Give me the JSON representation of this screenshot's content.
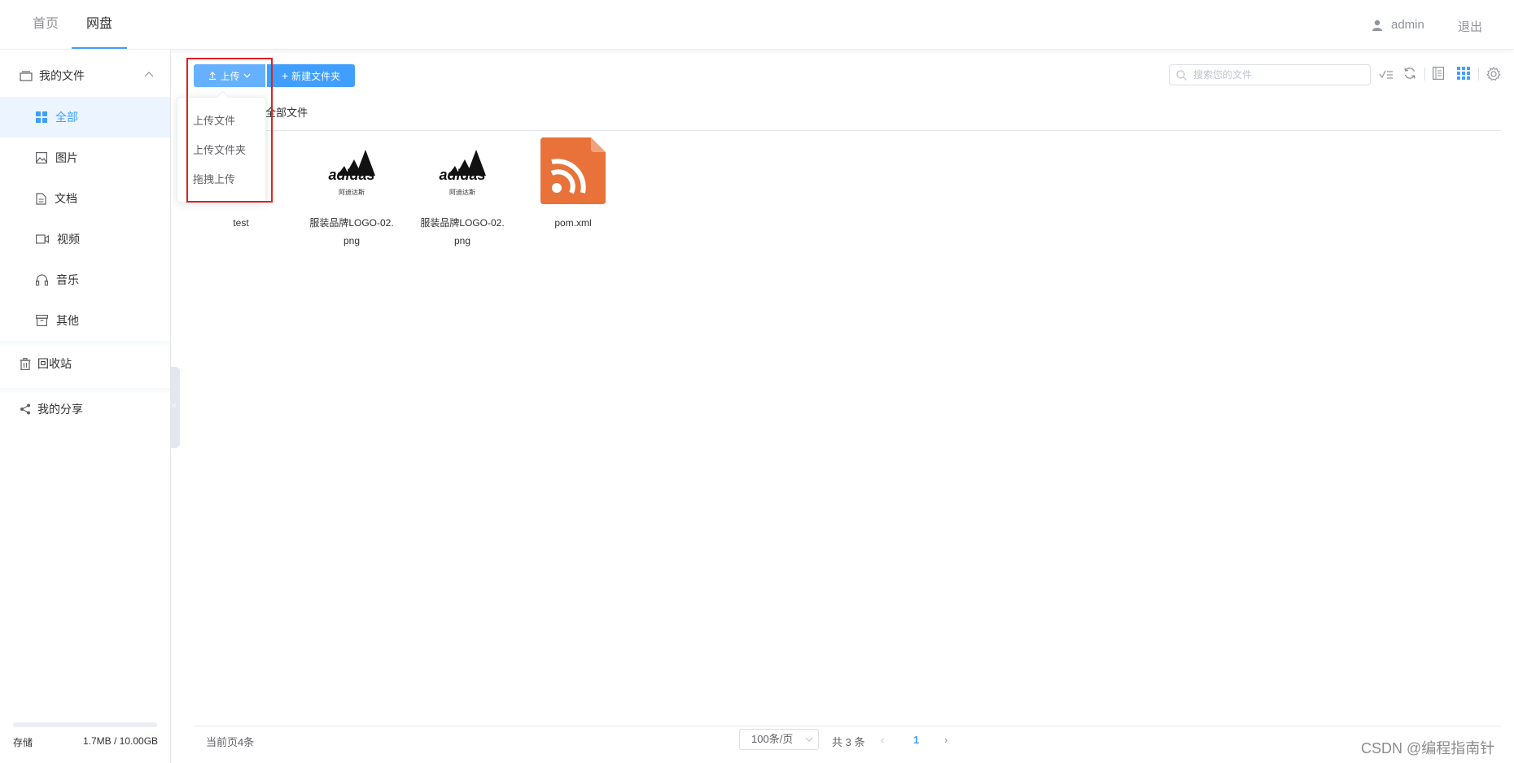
{
  "nav": {
    "home": "首页",
    "disk": "网盘",
    "user": "admin",
    "logout": "退出"
  },
  "sidebar": {
    "group": "我的文件",
    "items": [
      {
        "label": "全部",
        "icon": "grid-icon",
        "active": true
      },
      {
        "label": "图片",
        "icon": "image-icon"
      },
      {
        "label": "文档",
        "icon": "document-icon"
      },
      {
        "label": "视频",
        "icon": "video-icon"
      },
      {
        "label": "音乐",
        "icon": "headphones-icon"
      },
      {
        "label": "其他",
        "icon": "archive-icon"
      }
    ],
    "recycle": "回收站",
    "share": "我的分享",
    "storage_label": "存储",
    "storage_value": "1.7MB / 10.00GB",
    "storage_fraction": 0.0002
  },
  "toolbar": {
    "upload": "上传",
    "new_folder": "新建文件夹",
    "search_placeholder": "搜索您的文件"
  },
  "upload_menu": [
    "上传文件",
    "上传文件夹",
    "拖拽上传"
  ],
  "breadcrumb": "全部文件",
  "files": [
    {
      "name": "test",
      "type": "folder"
    },
    {
      "name": "服装品牌LOGO-02.png",
      "type": "image",
      "logo_text": "adidas",
      "logo_sub": "阿迪达斯"
    },
    {
      "name": "服装品牌LOGO-02.png",
      "type": "image",
      "logo_text": "adidas",
      "logo_sub": "阿迪达斯"
    },
    {
      "name": "pom.xml",
      "type": "xml"
    }
  ],
  "footer": {
    "page_count": "当前页4条",
    "page_size": "100条/页",
    "total": "共 3 条",
    "current_page": "1"
  },
  "watermark": "CSDN @编程指南针",
  "colors": {
    "primary": "#409eff",
    "upload_btn": "#66b1ff",
    "highlight_box": "#e02020",
    "xml_icon": "#e8723a"
  }
}
